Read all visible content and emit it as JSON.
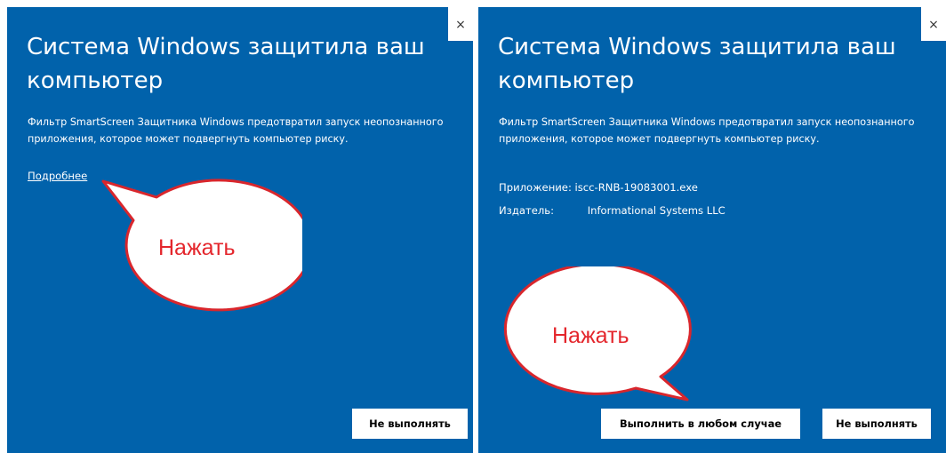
{
  "dialogs": {
    "left": {
      "close_glyph": "×",
      "title": "Система Windows защитила ваш компьютер",
      "description": "Фильтр SmartScreen Защитника Windows предотвратил запуск неопознанного приложения, которое может подвергнуть компьютер риску.",
      "more_link": "Подробнее",
      "dont_run_button": "Не выполнять"
    },
    "right": {
      "close_glyph": "×",
      "title": "Система Windows защитила ваш компьютер",
      "description": "Фильтр SmartScreen Защитника Windows предотвратил запуск неопознанного приложения, которое может подвергнуть компьютер риску.",
      "app_label": "Приложение:",
      "app_value": "iscc-RNB-19083001.exe",
      "publisher_label": "Издатель:",
      "publisher_value": "Informational Systems LLC",
      "run_anyway_button": "Выполнить в любом случае",
      "dont_run_button": "Не выполнять"
    }
  },
  "annotations": {
    "left_callout": "Нажать",
    "right_callout": "Нажать"
  },
  "colors": {
    "dialog_background": "#0162ab",
    "callout_border": "#d9262c",
    "callout_text": "#e4262c"
  }
}
